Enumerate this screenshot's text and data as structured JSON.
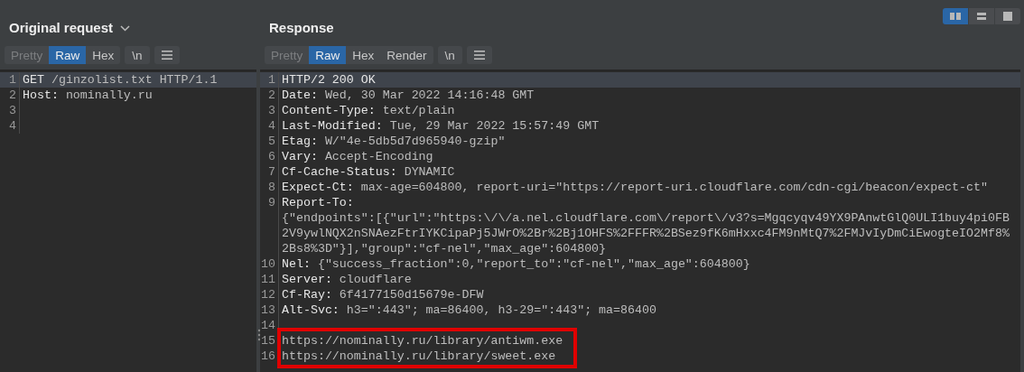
{
  "layout_toggle": [
    {
      "kind": "side",
      "selected": true
    },
    {
      "kind": "stacked",
      "selected": false
    },
    {
      "kind": "single",
      "selected": false
    }
  ],
  "request": {
    "title": "Original request",
    "tabs": [
      {
        "label": "Pretty",
        "selected": false,
        "disabled": true
      },
      {
        "label": "Raw",
        "selected": true,
        "disabled": false
      },
      {
        "label": "Hex",
        "selected": false,
        "disabled": false
      }
    ],
    "newline_button": "\\n",
    "lines": [
      {
        "number": "1",
        "key": "GET",
        "value": "/ginzolist.txt HTTP/1.1",
        "selected": true
      },
      {
        "number": "2",
        "key": "Host:",
        "value": "nominally.ru",
        "selected": false
      },
      {
        "number": "3",
        "selected": false
      },
      {
        "number": "4",
        "selected": false
      }
    ]
  },
  "response": {
    "title": "Response",
    "tabs": [
      {
        "label": "Pretty",
        "selected": false,
        "disabled": true
      },
      {
        "label": "Raw",
        "selected": true,
        "disabled": false
      },
      {
        "label": "Hex",
        "selected": false,
        "disabled": false
      },
      {
        "label": "Render",
        "selected": false,
        "disabled": false
      }
    ],
    "newline_button": "\\n",
    "lines": [
      {
        "number": "1",
        "key": "HTTP/2 200 OK",
        "selected": true
      },
      {
        "number": "2",
        "key": "Date:",
        "value": "Wed, 30 Mar 2022 14:16:48 GMT",
        "selected": false
      },
      {
        "number": "3",
        "key": "Content-Type:",
        "value": "text/plain",
        "selected": false
      },
      {
        "number": "4",
        "key": "Last-Modified:",
        "value": "Tue, 29 Mar 2022 15:57:49 GMT",
        "selected": false
      },
      {
        "number": "5",
        "key": "Etag:",
        "value": "W/\"4e-5db5d7d965940-gzip\"",
        "selected": false
      },
      {
        "number": "6",
        "key": "Vary:",
        "value": "Accept-Encoding",
        "selected": false
      },
      {
        "number": "7",
        "key": "Cf-Cache-Status:",
        "value": "DYNAMIC",
        "selected": false
      },
      {
        "number": "8",
        "key": "Expect-Ct:",
        "value": "max-age=604800, report-uri=\"https://report-uri.cloudflare.com/cdn-cgi/beacon/expect-ct\"",
        "selected": false
      },
      {
        "number": "9",
        "key": "Report-To:",
        "continuation": [
          "{\"endpoints\":[{\"url\":\"https:\\/\\/a.nel.cloudflare.com\\/report\\/v3?s=Mgqcyqv49YX9PAnwtGlQ0ULI1buy4pi0FB",
          "2V9ywlNQX2nSNAezFtrIYKCipaPj5JWrO%2Br%2Bj1OHFS%2FFFR%2BSez9fK6mHxxc4FM9nMtQ7%2FMJvIyDmCiEwogteIO2Mf8%",
          "2Bs8%3D\"}],\"group\":\"cf-nel\",\"max_age\":604800}"
        ],
        "selected": false
      },
      {
        "number": "10",
        "key": "Nel:",
        "value": "{\"success_fraction\":0,\"report_to\":\"cf-nel\",\"max_age\":604800}",
        "selected": false
      },
      {
        "number": "11",
        "key": "Server:",
        "value": "cloudflare",
        "selected": false
      },
      {
        "number": "12",
        "key": "Cf-Ray:",
        "value": "6f4177150d15679e-DFW",
        "selected": false
      },
      {
        "number": "13",
        "key": "Alt-Svc:",
        "value": "h3=\":443\"; ma=86400, h3-29=\":443\"; ma=86400",
        "selected": false
      },
      {
        "number": "14",
        "selected": false
      },
      {
        "number": "15",
        "text": "https://nominally.ru/library/antiwm.exe",
        "selected": false,
        "outlined": true
      },
      {
        "number": "16",
        "text": "https://nominally.ru/library/sweet.exe",
        "selected": false,
        "outlined": true
      }
    ]
  }
}
